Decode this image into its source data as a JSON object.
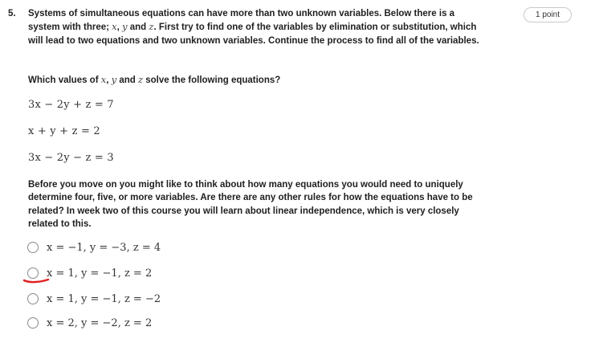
{
  "question": {
    "number": "5.",
    "points": "1 point",
    "intro": {
      "part1": "Systems of simultaneous equations can have more than two unknown variables. Below there is a system with three; ",
      "var_x": "x",
      "sep1": ", ",
      "var_y": "y",
      "sep2": " and ",
      "var_z": "z",
      "part2": ". First try to find one of the variables by elimination or substitution, which will lead to two equations and two unknown variables. Continue the process to find all of the variables."
    },
    "prompt": {
      "part1": "Which values of ",
      "var_x": "x",
      "sep1": ", ",
      "var_y": "y",
      "sep2": " and ",
      "var_z": "z",
      "part2": " solve the following equations?"
    },
    "equations": [
      "3x − 2y + z = 7",
      "x + y + z = 2",
      "3x − 2y − z = 3"
    ],
    "followup": "Before you move on you might like to think about how many equations you would need to uniquely determine four, five, or more variables. Are there are any other rules for how the equations have to be related? In week two of this course you will learn about linear independence, which is very closely related to this.",
    "options": [
      "x = −1, y = −3, z = 4",
      "x = 1, y = −1, z = 2",
      "x = 1, y = −1, z = −2",
      "x = 2, y = −2, z = 2"
    ]
  },
  "colors": {
    "annotation_mark": "#e02020",
    "radio_border": "#8a8a8a",
    "text": "#1f1f1f"
  }
}
